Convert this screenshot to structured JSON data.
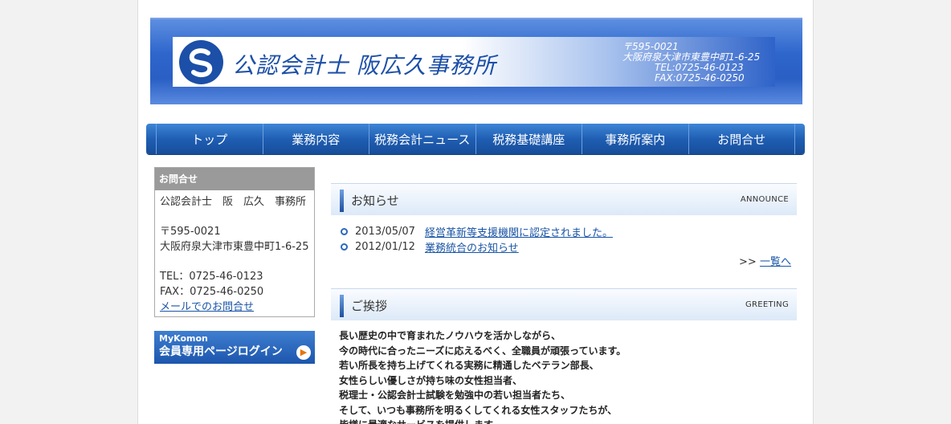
{
  "header": {
    "firm_name": "公認会計士 阪広久事務所",
    "postal": "〒595-0021",
    "address": "大阪府泉大津市東豊中町1-6-25",
    "tel": "TEL:0725-46-0123",
    "fax": "FAX:0725-46-0250",
    "logo_icon": "firm-logo-mark"
  },
  "nav": {
    "items": [
      "トップ",
      "業務内容",
      "税務会計ニュース",
      "税務基礎講座",
      "事務所案内",
      "お問合せ"
    ]
  },
  "sidebar": {
    "contact_heading": "お問合せ",
    "firm": "公認会計士　阪　広久　事務所",
    "postal": "〒595-0021",
    "address": "大阪府泉大津市東豊中町1-6-25",
    "tel": "TEL：0725-46-0123",
    "fax": "FAX：0725-46-0250",
    "mail_link": "メールでのお問合せ",
    "login_small": "MyKomon",
    "login_big": "会員専用ページログイン",
    "login_icon": "play-arrow-icon"
  },
  "news": {
    "title": "お知らせ",
    "en_title": "ANNOUNCE",
    "items": [
      {
        "date": "2013/05/07",
        "text": "経営革新等支援機関に認定されました。"
      },
      {
        "date": "2012/01/12",
        "text": "業務統合のお知らせ"
      }
    ],
    "more_prefix": ">>",
    "more_link": "一覧へ"
  },
  "greeting": {
    "title": "ご挨拶",
    "en_title": "GREETING",
    "lines": [
      "長い歴史の中で育まれたノウハウを活かしながら、",
      "今の時代に合ったニーズに応えるべく、全職員が頑張っています。",
      "若い所長を持ち上げてくれる実務に精通したベテラン部長、",
      "女性らしい優しさが持ち味の女性担当者、",
      "税理士・公認会計士試験を勉強中の若い担当者たち、",
      "そして、いつも事務所を明るくしてくれる女性スタッフたちが、",
      "皆様に最適なサービスを提供します。"
    ]
  },
  "colors": {
    "brand_blue": "#1c4fa8",
    "nav_blue": "#1f5eb3",
    "link": "#1a55a6"
  }
}
